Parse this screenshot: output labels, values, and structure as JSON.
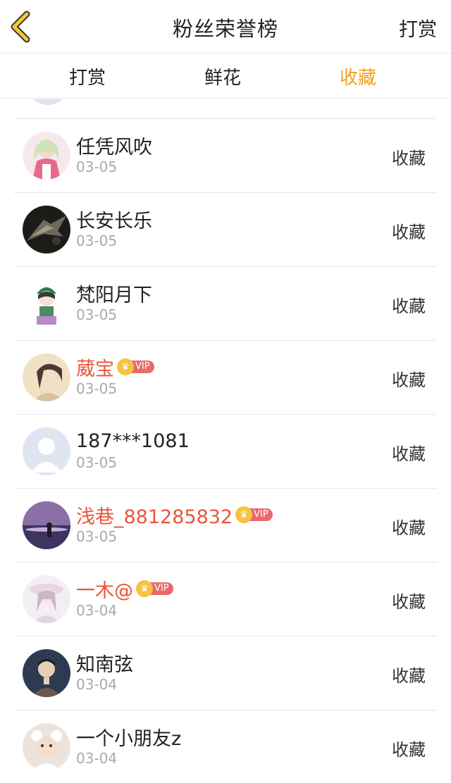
{
  "header": {
    "title": "粉丝荣誉榜",
    "action_label": "打赏",
    "back_icon": "chevron-left-icon"
  },
  "tabs": [
    {
      "label": "打赏",
      "active": false
    },
    {
      "label": "鲜花",
      "active": false
    },
    {
      "label": "收藏",
      "active": true
    }
  ],
  "colors": {
    "accent": "#f0a020",
    "vip_name": "#e8563a",
    "vip_tag": "#e86a6a",
    "crown": "#f6c343",
    "date": "#a9a9a9"
  },
  "rows": [
    {
      "name": "任凭风吹",
      "date": "03-05",
      "action": "收藏",
      "vip": false,
      "vip_label": ""
    },
    {
      "name": "长安长乐",
      "date": "03-05",
      "action": "收藏",
      "vip": false,
      "vip_label": ""
    },
    {
      "name": "梵阳月下",
      "date": "03-05",
      "action": "收藏",
      "vip": false,
      "vip_label": ""
    },
    {
      "name": "葳宝",
      "date": "03-05",
      "action": "收藏",
      "vip": true,
      "vip_label": "VIP"
    },
    {
      "name": "187***1081",
      "date": "03-05",
      "action": "收藏",
      "vip": false,
      "vip_label": ""
    },
    {
      "name": "浅巷_881285832",
      "date": "03-05",
      "action": "收藏",
      "vip": true,
      "vip_label": "VIP"
    },
    {
      "name": "一木@",
      "date": "03-04",
      "action": "收藏",
      "vip": true,
      "vip_label": "VIP"
    },
    {
      "name": "知南弦",
      "date": "03-04",
      "action": "收藏",
      "vip": false,
      "vip_label": ""
    },
    {
      "name": "一个小朋友z",
      "date": "03-04",
      "action": "收藏",
      "vip": false,
      "vip_label": ""
    }
  ]
}
